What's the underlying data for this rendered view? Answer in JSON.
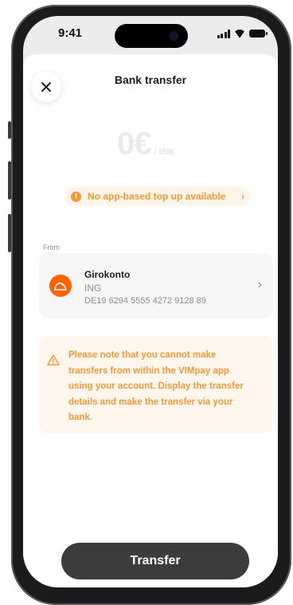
{
  "status_bar": {
    "time": "9:41"
  },
  "header": {
    "title": "Bank transfer",
    "close_icon": "close-icon"
  },
  "amount": {
    "value": "0€",
    "limit": "/ 150€"
  },
  "info_pill": {
    "text": "No app-based top up available",
    "icon": "warning-circle-icon",
    "chevron": "›"
  },
  "from": {
    "label": "From",
    "account": {
      "name": "Girokonto",
      "bank": "ING",
      "iban": "DE19 6294 5555 4272 9128 89",
      "logo_color": "#ff6200"
    }
  },
  "notice": {
    "text": "Please note that you cannot make transfers from within the VIMpay app using your account. Display the transfer details and make the transfer via your bank.",
    "icon": "warning-triangle-icon",
    "color": "#f2993a"
  },
  "primary_button": {
    "label": "Transfer"
  }
}
